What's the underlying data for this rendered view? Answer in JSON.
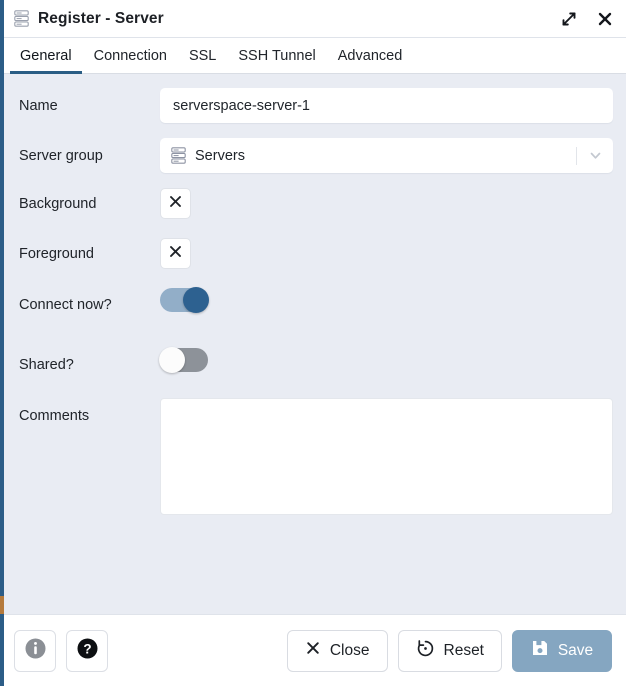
{
  "window": {
    "title": "Register - Server",
    "icon": "server-stack-icon",
    "maximize_icon": "expand-diagonal-icon",
    "close_icon": "close-x-icon"
  },
  "tabs": [
    {
      "label": "General",
      "active": true
    },
    {
      "label": "Connection",
      "active": false
    },
    {
      "label": "SSL",
      "active": false
    },
    {
      "label": "SSH Tunnel",
      "active": false
    },
    {
      "label": "Advanced",
      "active": false
    }
  ],
  "form": {
    "name": {
      "label": "Name",
      "value": "serverspace-server-1",
      "placeholder": ""
    },
    "server_group": {
      "label": "Server group",
      "value": "Servers",
      "icon": "server-stack-icon",
      "arrow_icon": "chevron-down-icon"
    },
    "background": {
      "label": "Background",
      "swatch_icon": "clear-x-icon",
      "value": ""
    },
    "foreground": {
      "label": "Foreground",
      "swatch_icon": "clear-x-icon",
      "value": ""
    },
    "connect_now": {
      "label": "Connect now?",
      "state": "on"
    },
    "shared": {
      "label": "Shared?",
      "state": "off"
    },
    "comments": {
      "label": "Comments",
      "value": "",
      "placeholder": ""
    }
  },
  "footer": {
    "info": {
      "label": "",
      "icon": "info-circle-icon"
    },
    "help": {
      "label": "",
      "icon": "help-circle-icon"
    },
    "close": {
      "label": "Close",
      "icon": "close-x-icon"
    },
    "reset": {
      "label": "Reset",
      "icon": "reset-arrow-icon"
    },
    "save": {
      "label": "Save",
      "icon": "save-floppy-icon"
    }
  },
  "colors": {
    "accent": "#2a5d84",
    "body_bg": "#e9ecf3",
    "toggle_on_track": "#92aec8",
    "toggle_on_knob": "#2d6190",
    "toggle_off_track": "#8d9299",
    "save_bg": "#85a6c1"
  }
}
